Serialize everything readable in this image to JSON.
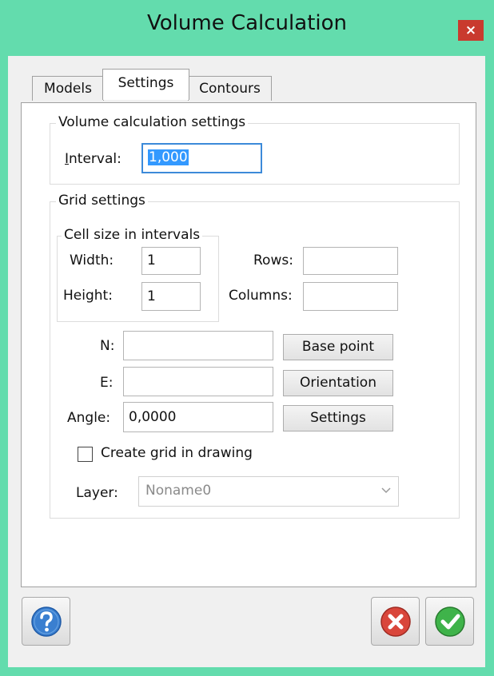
{
  "window": {
    "title": "Volume Calculation",
    "close_glyph": "×"
  },
  "tabs": [
    {
      "label": "Models"
    },
    {
      "label": "Settings"
    },
    {
      "label": "Contours"
    }
  ],
  "volume_group": {
    "title": "Volume calculation settings",
    "interval_label": "Interval:",
    "interval_value": "1,000"
  },
  "grid_group": {
    "title": "Grid settings",
    "cell_size": {
      "title": "Cell size in intervals",
      "width_label": "Width:",
      "width_value": "1",
      "height_label": "Height:",
      "height_value": "1"
    },
    "rows_label": "Rows:",
    "rows_value": "",
    "columns_label": "Columns:",
    "columns_value": "",
    "n_label": "N:",
    "n_value": "",
    "e_label": "E:",
    "e_value": "",
    "angle_label": "Angle:",
    "angle_value": "0,0000",
    "base_point_button": "Base point",
    "orientation_button": "Orientation",
    "settings_button": "Settings",
    "create_grid_label": "Create grid in drawing",
    "create_grid_checked": false,
    "layer_label": "Layer:",
    "layer_value": "Noname0"
  },
  "icons": {
    "help": "help-icon",
    "cancel": "cancel-icon",
    "ok": "ok-icon"
  },
  "colors": {
    "title_bar": "#63dcad",
    "close_button": "#c93a2e",
    "selection": "#3399ff",
    "help_blue": "#3a7fd0",
    "cancel_red": "#d9463b",
    "ok_green": "#3fb34a"
  }
}
